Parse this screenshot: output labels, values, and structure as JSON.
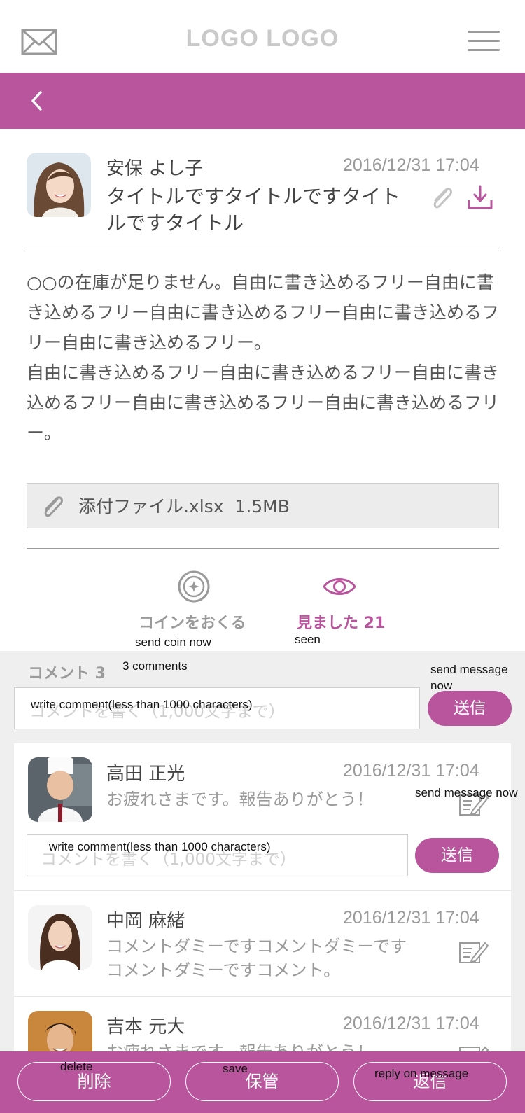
{
  "header": {
    "logo": "LOGO LOGO"
  },
  "message": {
    "sender": "安保 よし子",
    "date": "2016/12/31 17:04",
    "title": "タイトルですタイトルですタイトルですタイトル",
    "body": [
      "○○の在庫が足りません。自由に書き込めるフリー自由に書き込めるフリー自由に書き込めるフリー自由に書き込めるフリー自由に書き込めるフリー。",
      "自由に書き込めるフリー自由に書き込めるフリー自由に書き込めるフリー自由に書き込めるフリー自由に書き込めるフリー。"
    ],
    "attachment": {
      "name": "添付ファイル.xlsx",
      "size": "1.5MB"
    }
  },
  "actions": {
    "coin_label": "コインをおくる",
    "coin_note": "send coin now",
    "seen_label": "見ました 21",
    "seen_note": "seen"
  },
  "comments": {
    "label": "コメント 3",
    "label_note": "3 comments",
    "send_note": "send message now",
    "input_placeholder": "コメントを書く（1,000文字まで）",
    "input_overlay": "write comment(less than 1000 characters)",
    "send_label": "送信",
    "items": [
      {
        "name": "高田 正光",
        "date": "2016/12/31 17:04",
        "text": "お疲れさまです。報告ありがとう！",
        "edit_note": "send message now",
        "reply": {
          "placeholder": "コメントを書く（1,000文字まで）",
          "overlay": "write comment(less than 1000 characters)",
          "send_label": "送信"
        }
      },
      {
        "name": "中岡 麻緒",
        "date": "2016/12/31 17:04",
        "text": "コメントダミーですコメントダミーですコメントダミーですコメント。"
      },
      {
        "name": "吉本 元大",
        "date": "2016/12/31 17:04",
        "text": "お疲れさまです。報告ありがとう！"
      }
    ]
  },
  "footer": {
    "delete_label": "削除",
    "delete_note": "delete",
    "save_label": "保管",
    "save_note": "save",
    "reply_label": "返信",
    "reply_note": "reply on message"
  },
  "colors": {
    "brand": "#b8559d",
    "muted": "#9a9a9a",
    "panel": "#efefef"
  }
}
